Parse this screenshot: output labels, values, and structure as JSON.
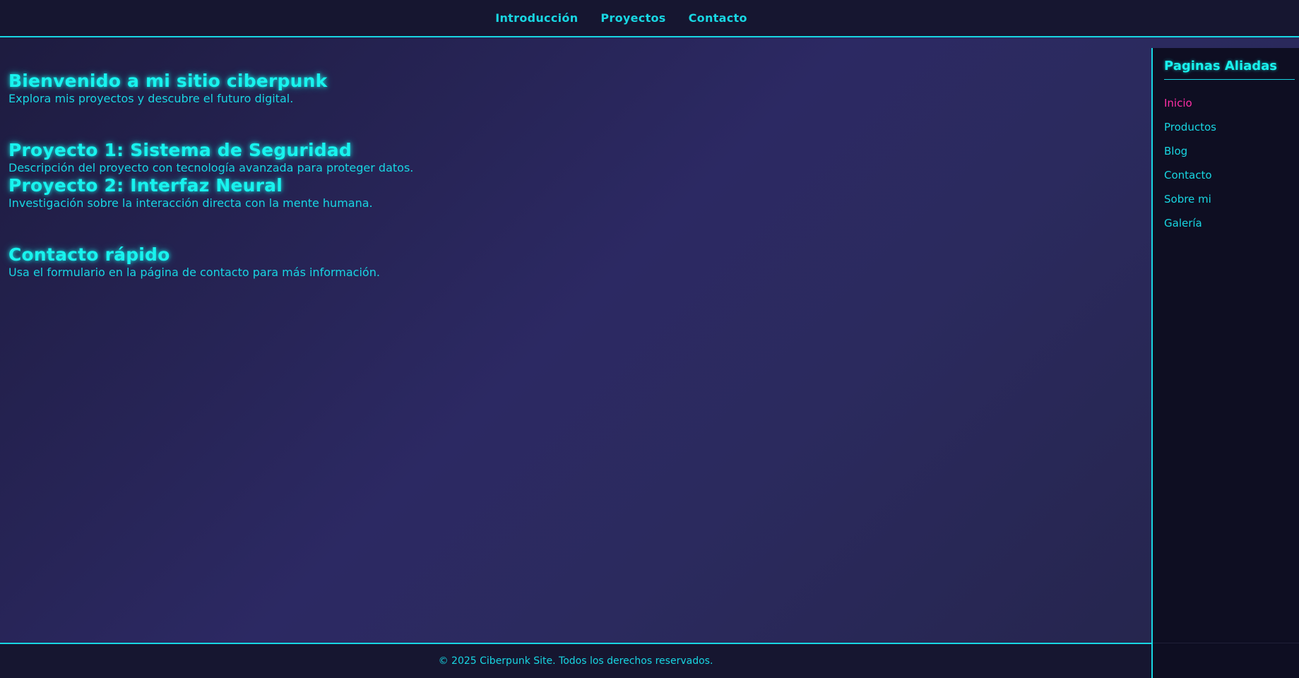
{
  "nav": {
    "items": [
      {
        "label": "Introducción"
      },
      {
        "label": "Proyectos"
      },
      {
        "label": "Contacto"
      }
    ]
  },
  "main": {
    "intro": {
      "title": "Bienvenido a mi sitio ciberpunk",
      "text": "Explora mis proyectos y descubre el futuro digital."
    },
    "projects": [
      {
        "title": "Proyecto 1: Sistema de Seguridad",
        "text": "Descripción del proyecto con tecnología avanzada para proteger datos."
      },
      {
        "title": "Proyecto 2: Interfaz Neural",
        "text": "Investigación sobre la interacción directa con la mente humana."
      }
    ],
    "contact": {
      "title": "Contacto rápido",
      "text": "Usa el formulario en la página de contacto para más información."
    }
  },
  "sidebar": {
    "title": "Paginas Aliadas",
    "items": [
      {
        "label": "Inicio",
        "active": true
      },
      {
        "label": "Productos"
      },
      {
        "label": "Blog"
      },
      {
        "label": "Contacto"
      },
      {
        "label": "Sobre mi"
      },
      {
        "label": "Galería"
      }
    ]
  },
  "footer": {
    "text": "© 2025 Ciberpunk Site. Todos los derechos reservados."
  },
  "colors": {
    "accent": "#18d6e2",
    "heading_glow": "#18f3ee",
    "active_link": "#ff2fa6",
    "background_dark": "#161630"
  }
}
